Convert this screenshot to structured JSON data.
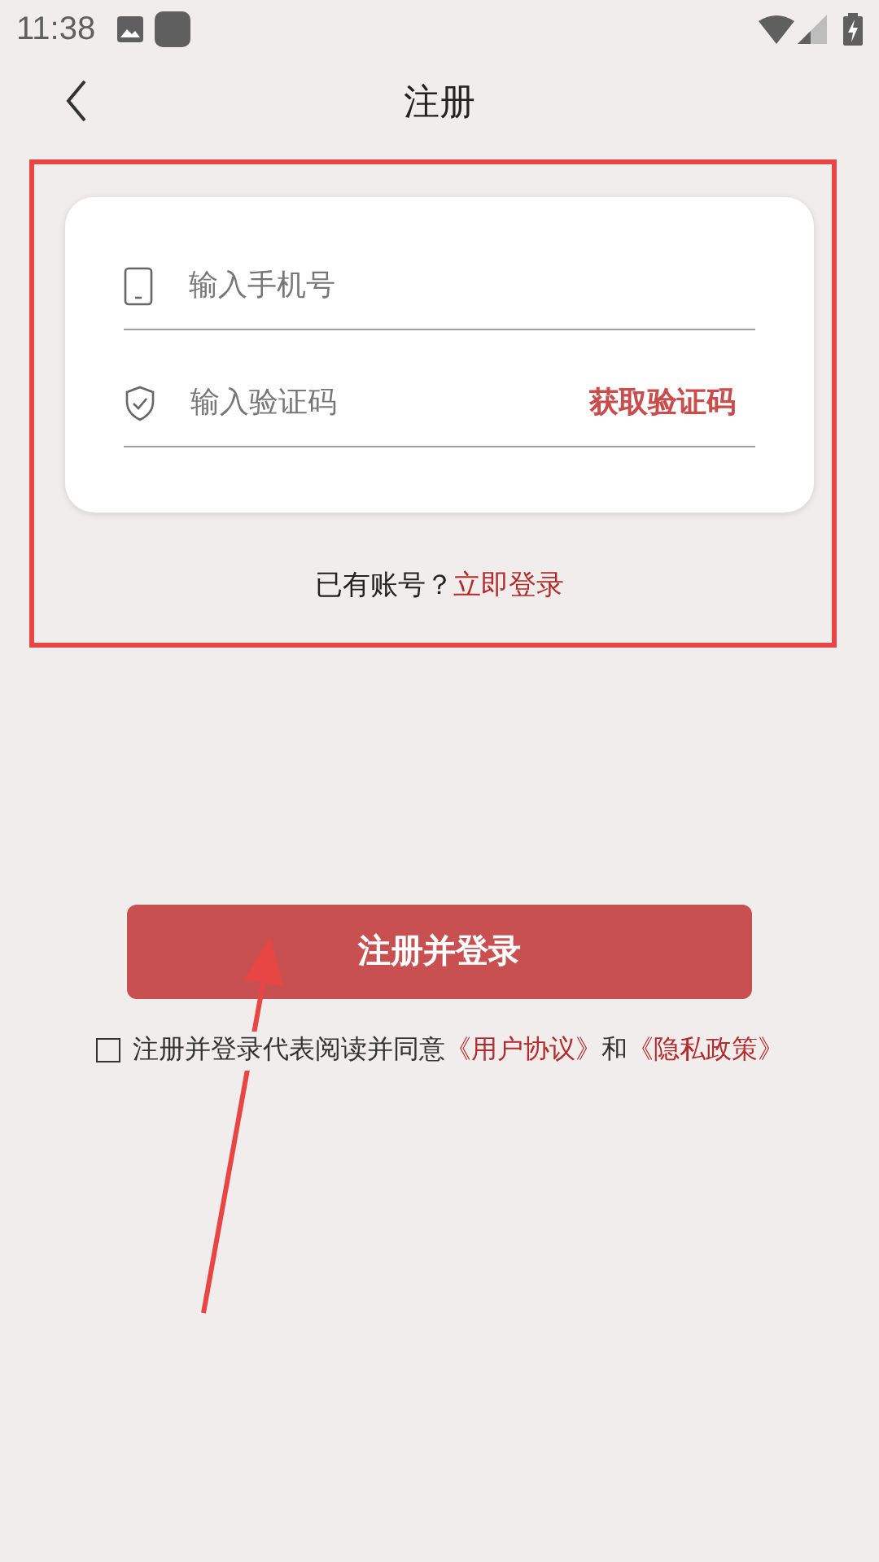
{
  "status_bar": {
    "time": "11:38"
  },
  "header": {
    "title": "注册"
  },
  "form": {
    "phone": {
      "placeholder": "输入手机号"
    },
    "code": {
      "placeholder": "输入验证码",
      "action": "获取验证码"
    }
  },
  "login_prompt": {
    "text": "已有账号？",
    "link": "立即登录"
  },
  "submit": {
    "label": "注册并登录"
  },
  "agreement": {
    "checked": false,
    "parts": [
      {
        "kind": "text",
        "text": "注册并登录代表阅读并同意"
      },
      {
        "kind": "link",
        "text": "《用户协议》"
      },
      {
        "kind": "text",
        "text": "和"
      },
      {
        "kind": "link",
        "text": "《隐私政策》"
      }
    ]
  }
}
